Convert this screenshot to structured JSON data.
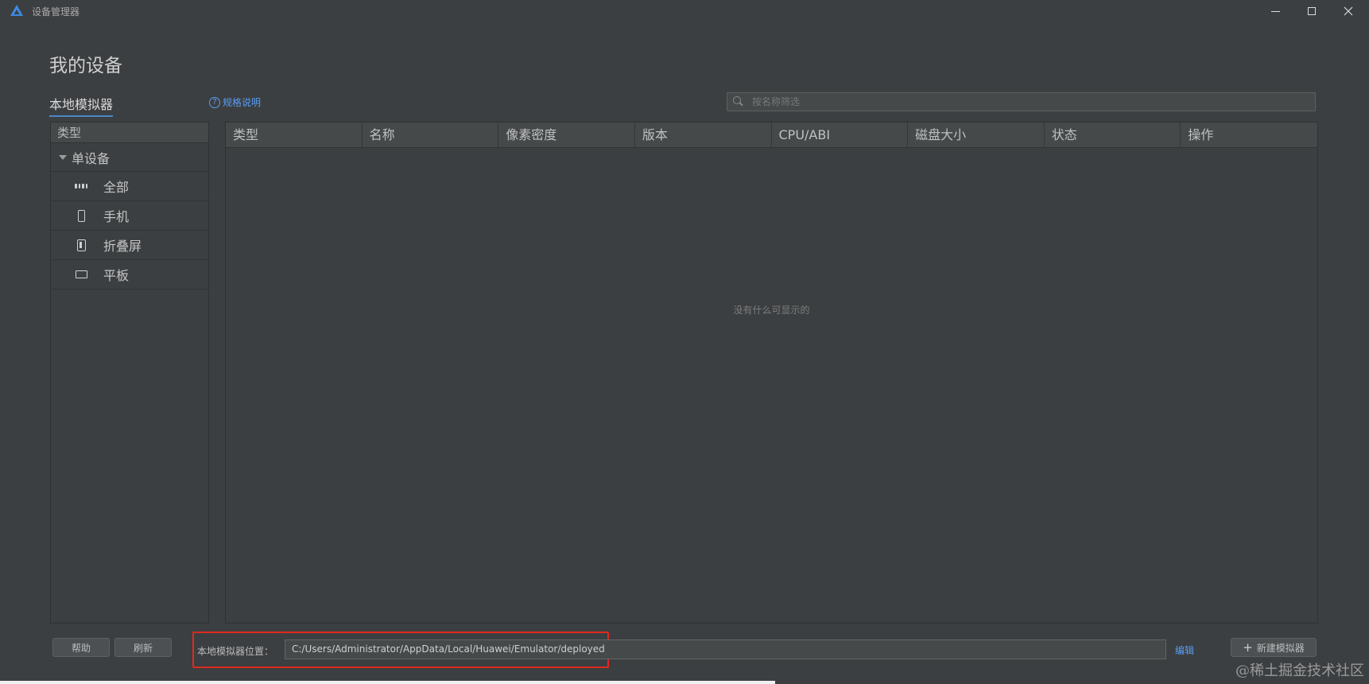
{
  "window": {
    "title": "设备管理器"
  },
  "page": {
    "title": "我的设备"
  },
  "tabs": {
    "local": "本地模拟器"
  },
  "spec": {
    "icon": "help-circle-icon",
    "label": "规格说明"
  },
  "search": {
    "placeholder": "按名称筛选"
  },
  "type_panel": {
    "header": "类型",
    "group": "单设备",
    "items": [
      {
        "label": "全部",
        "icon": "grid-icon"
      },
      {
        "label": "手机",
        "icon": "phone-icon"
      },
      {
        "label": "折叠屏",
        "icon": "foldable-icon"
      },
      {
        "label": "平板",
        "icon": "tablet-icon"
      }
    ]
  },
  "table": {
    "columns": [
      "类型",
      "名称",
      "像素密度",
      "版本",
      "CPU/ABI",
      "磁盘大小",
      "状态",
      "操作"
    ],
    "empty_text": "没有什么可显示的"
  },
  "footer": {
    "help_label": "帮助",
    "refresh_label": "刷新",
    "location_label": "本地模拟器位置：",
    "location_value": "C:/Users/Administrator/AppData/Local/Huawei/Emulator/deployed",
    "edit_label": "编辑",
    "new_label": "新建模拟器"
  },
  "watermark": "@稀土掘金技术社区",
  "colors": {
    "accent": "#589df6",
    "highlight": "#e0291f",
    "background": "#3c3f41"
  }
}
